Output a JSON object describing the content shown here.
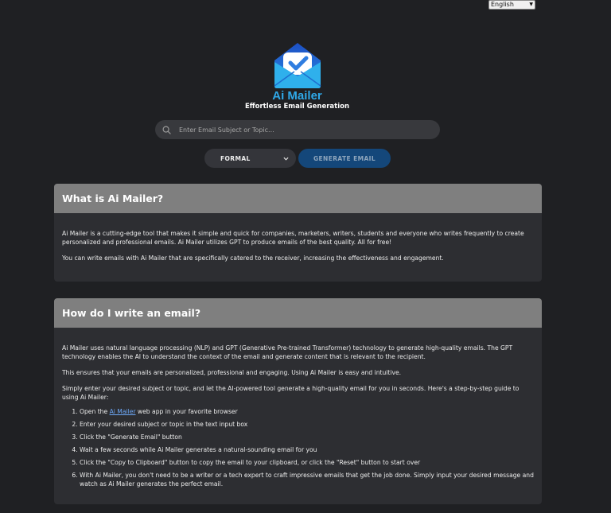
{
  "language_select": {
    "value": "English"
  },
  "brand": {
    "name": "Ai Mailer",
    "tagline": "Effortless Email Generation",
    "colors": {
      "accent": "#2fa8e8",
      "dark": "#1a62c9"
    }
  },
  "search": {
    "placeholder": "Enter Email Subject or Topic...",
    "value": ""
  },
  "tone_select": {
    "value": "FORMAL"
  },
  "generate_button": {
    "label": "GENERATE EMAIL"
  },
  "what_is": {
    "title": "What is Ai Mailer?",
    "paragraphs": [
      "Ai Mailer is a cutting-edge tool that makes it simple and quick for companies, marketers, writers, students and everyone who writes frequently to create personalized and professional emails. Ai Mailer utilizes GPT to produce emails of the best quality. All for free!",
      "You can write emails with Ai Mailer that are specifically catered to the receiver, increasing the effectiveness and engagement."
    ]
  },
  "how_to": {
    "title": "How do I write an email?",
    "paragraphs": [
      "Ai Mailer uses natural language processing (NLP) and GPT (Generative Pre-trained Transformer) technology to generate high-quality emails. The GPT technology enables the AI to understand the context of the email and generate content that is relevant to the recipient.",
      "This ensures that your emails are personalized, professional and engaging. Using Ai Mailer is easy and intuitive.",
      "Simply enter your desired subject or topic, and let the AI-powered tool generate a high-quality email for you in seconds. Here's a step-by-step guide to using Ai Mailer:"
    ],
    "step1": {
      "before": "Open the ",
      "link": "Ai Mailer",
      "after": " web app in your favorite browser"
    },
    "steps": [
      "Enter your desired subject or topic in the text input box",
      "Click the \"Generate Email\" button",
      "Wait a few seconds while Ai Mailer generates a natural-sounding email for you",
      "Click the \"Copy to Clipboard\" button to copy the email to your clipboard, or click the \"Reset\" button to start over",
      "With Ai Mailer, you don't need to be a writer or a tech expert to craft impressive emails that get the job done. Simply input your desired message and watch as Ai Mailer generates the perfect email."
    ]
  }
}
